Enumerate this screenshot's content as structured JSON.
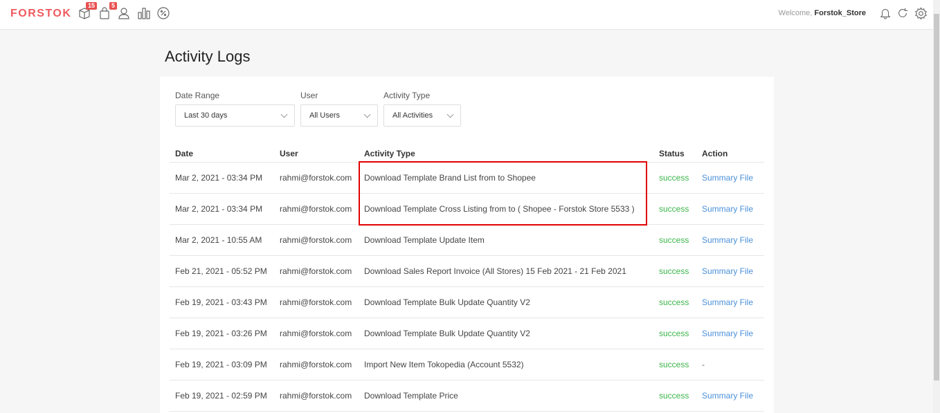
{
  "header": {
    "logo": "FORSTOK",
    "orders_badge": "15",
    "products_badge": "5",
    "welcome_prefix": "Welcome,",
    "store_name": "Forstok_Store"
  },
  "page": {
    "title": "Activity Logs"
  },
  "filters": {
    "date_range": {
      "label": "Date Range",
      "value": "Last 30 days"
    },
    "user": {
      "label": "User",
      "value": "All Users"
    },
    "activity_type": {
      "label": "Activity Type",
      "value": "All Activities"
    }
  },
  "table": {
    "columns": [
      "Date",
      "User",
      "Activity Type",
      "Status",
      "Action"
    ],
    "rows": [
      {
        "date": "Mar 2, 2021 - 03:34 PM",
        "user": "rahmi@forstok.com",
        "activity": "Download Template Brand List from to Shopee",
        "status": "success",
        "action": "Summary File"
      },
      {
        "date": "Mar 2, 2021 - 03:34 PM",
        "user": "rahmi@forstok.com",
        "activity": "Download Template Cross Listing from to ( Shopee - Forstok Store 5533 )",
        "status": "success",
        "action": "Summary File"
      },
      {
        "date": "Mar 2, 2021 - 10:55 AM",
        "user": "rahmi@forstok.com",
        "activity": "Download Template Update Item",
        "status": "success",
        "action": "Summary File"
      },
      {
        "date": "Feb 21, 2021 - 05:52 PM",
        "user": "rahmi@forstok.com",
        "activity": "Download Sales Report Invoice (All Stores) 15 Feb 2021 - 21 Feb 2021",
        "status": "success",
        "action": "Summary File"
      },
      {
        "date": "Feb 19, 2021 - 03:43 PM",
        "user": "rahmi@forstok.com",
        "activity": "Download Template Bulk Update Quantity V2",
        "status": "success",
        "action": "Summary File"
      },
      {
        "date": "Feb 19, 2021 - 03:26 PM",
        "user": "rahmi@forstok.com",
        "activity": "Download Template Bulk Update Quantity V2",
        "status": "success",
        "action": "Summary File"
      },
      {
        "date": "Feb 19, 2021 - 03:09 PM",
        "user": "rahmi@forstok.com",
        "activity": "Import New Item Tokopedia (Account 5532)",
        "status": "success",
        "action": "-"
      },
      {
        "date": "Feb 19, 2021 - 02:59 PM",
        "user": "rahmi@forstok.com",
        "activity": "Download Template Price",
        "status": "success",
        "action": "Summary File"
      }
    ]
  },
  "colors": {
    "brand": "#f05a5f",
    "success": "#3bb54a",
    "link": "#4a90d9",
    "highlight": "#e00000"
  }
}
